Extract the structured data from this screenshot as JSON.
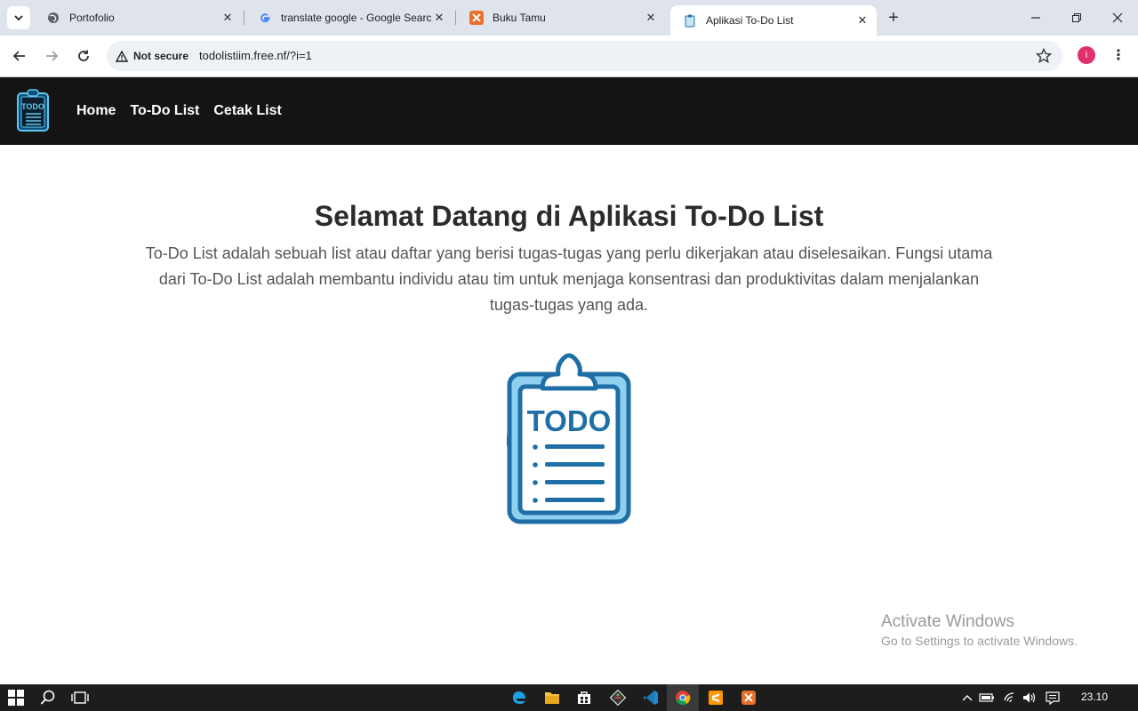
{
  "browser": {
    "tabs": [
      {
        "title": "Portofolio",
        "active": false
      },
      {
        "title": "translate google - Google Search",
        "active": false
      },
      {
        "title": "Buku Tamu",
        "active": false
      },
      {
        "title": "Aplikasi To-Do List",
        "active": true
      }
    ],
    "security_label": "Not secure",
    "url": "todolistiim.free.nf/?i=1",
    "profile_initial": "i"
  },
  "site": {
    "nav": [
      "Home",
      "To-Do List",
      "Cetak List"
    ],
    "logo_text": "TODO",
    "headline": "Selamat Datang di Aplikasi To-Do List",
    "intro": "To-Do List adalah sebuah list atau daftar yang berisi tugas-tugas yang perlu dikerjakan atau diselesaikan. Fungsi utama dari To-Do List adalah membantu individu atau tim untuk menjaga konsentrasi dan produktivitas dalam menjalankan tugas-tugas yang ada.",
    "hero_text": "TODO"
  },
  "watermark": {
    "line1": "Activate Windows",
    "line2": "Go to Settings to activate Windows."
  },
  "taskbar": {
    "clock": "23.10"
  },
  "colors": {
    "accent_blue": "#1f6ea6",
    "light_blue": "#8fd0ef",
    "header_bg": "#141414"
  }
}
